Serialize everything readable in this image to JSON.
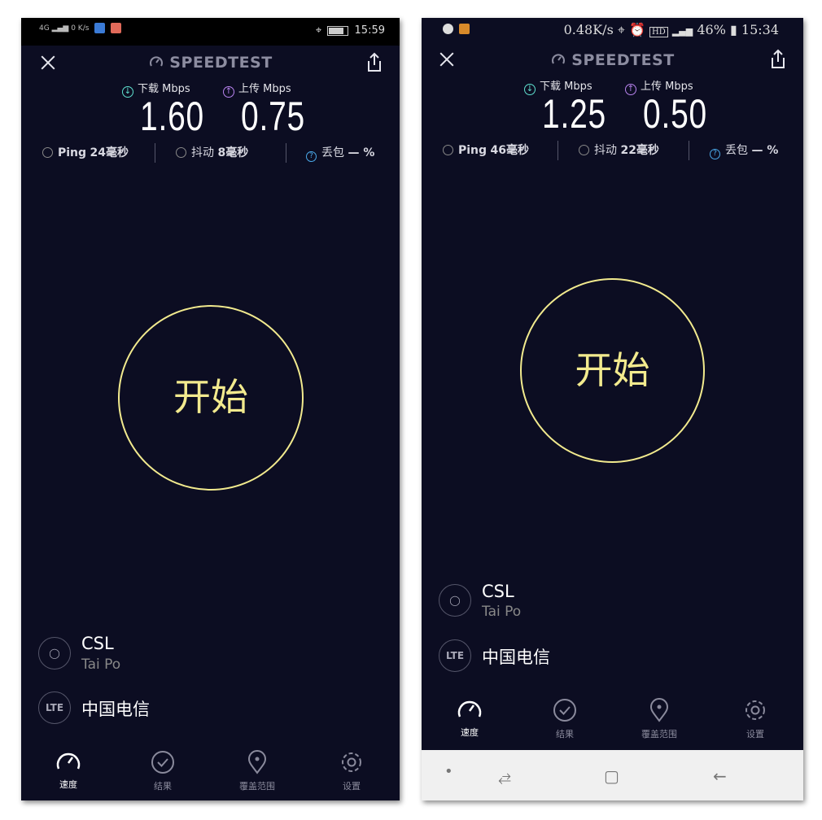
{
  "brand": "SPEEDTEST",
  "download_label": "下载 Mbps",
  "upload_label": "上传 Mbps",
  "ping_label": "Ping",
  "jitter_label": "抖动",
  "loss_label": "丢包",
  "loss_value": "— %",
  "start_label": "开始",
  "isp_name": "CSL",
  "isp_location": "Tai Po",
  "lte_label": "LTE",
  "carrier": "中国电信",
  "nav": {
    "speed": "速度",
    "results": "结果",
    "coverage": "覆盖范围",
    "settings": "设置"
  },
  "left": {
    "status": {
      "network": "4G",
      "speed": "0 K/s",
      "time": "15:59"
    },
    "download": "1.60",
    "upload": "0.75",
    "ping": "24毫秒",
    "jitter": "8毫秒"
  },
  "right": {
    "status": {
      "speed": "0.48K/s",
      "hd": "HD",
      "battery": "46%",
      "time": "15:34"
    },
    "download": "1.25",
    "upload": "0.50",
    "ping": "46毫秒",
    "jitter": "22毫秒"
  },
  "colors": {
    "background": "#0c0d22",
    "accent": "#f2ea8e",
    "download": "#5fe0cf",
    "upload": "#b984f0"
  }
}
